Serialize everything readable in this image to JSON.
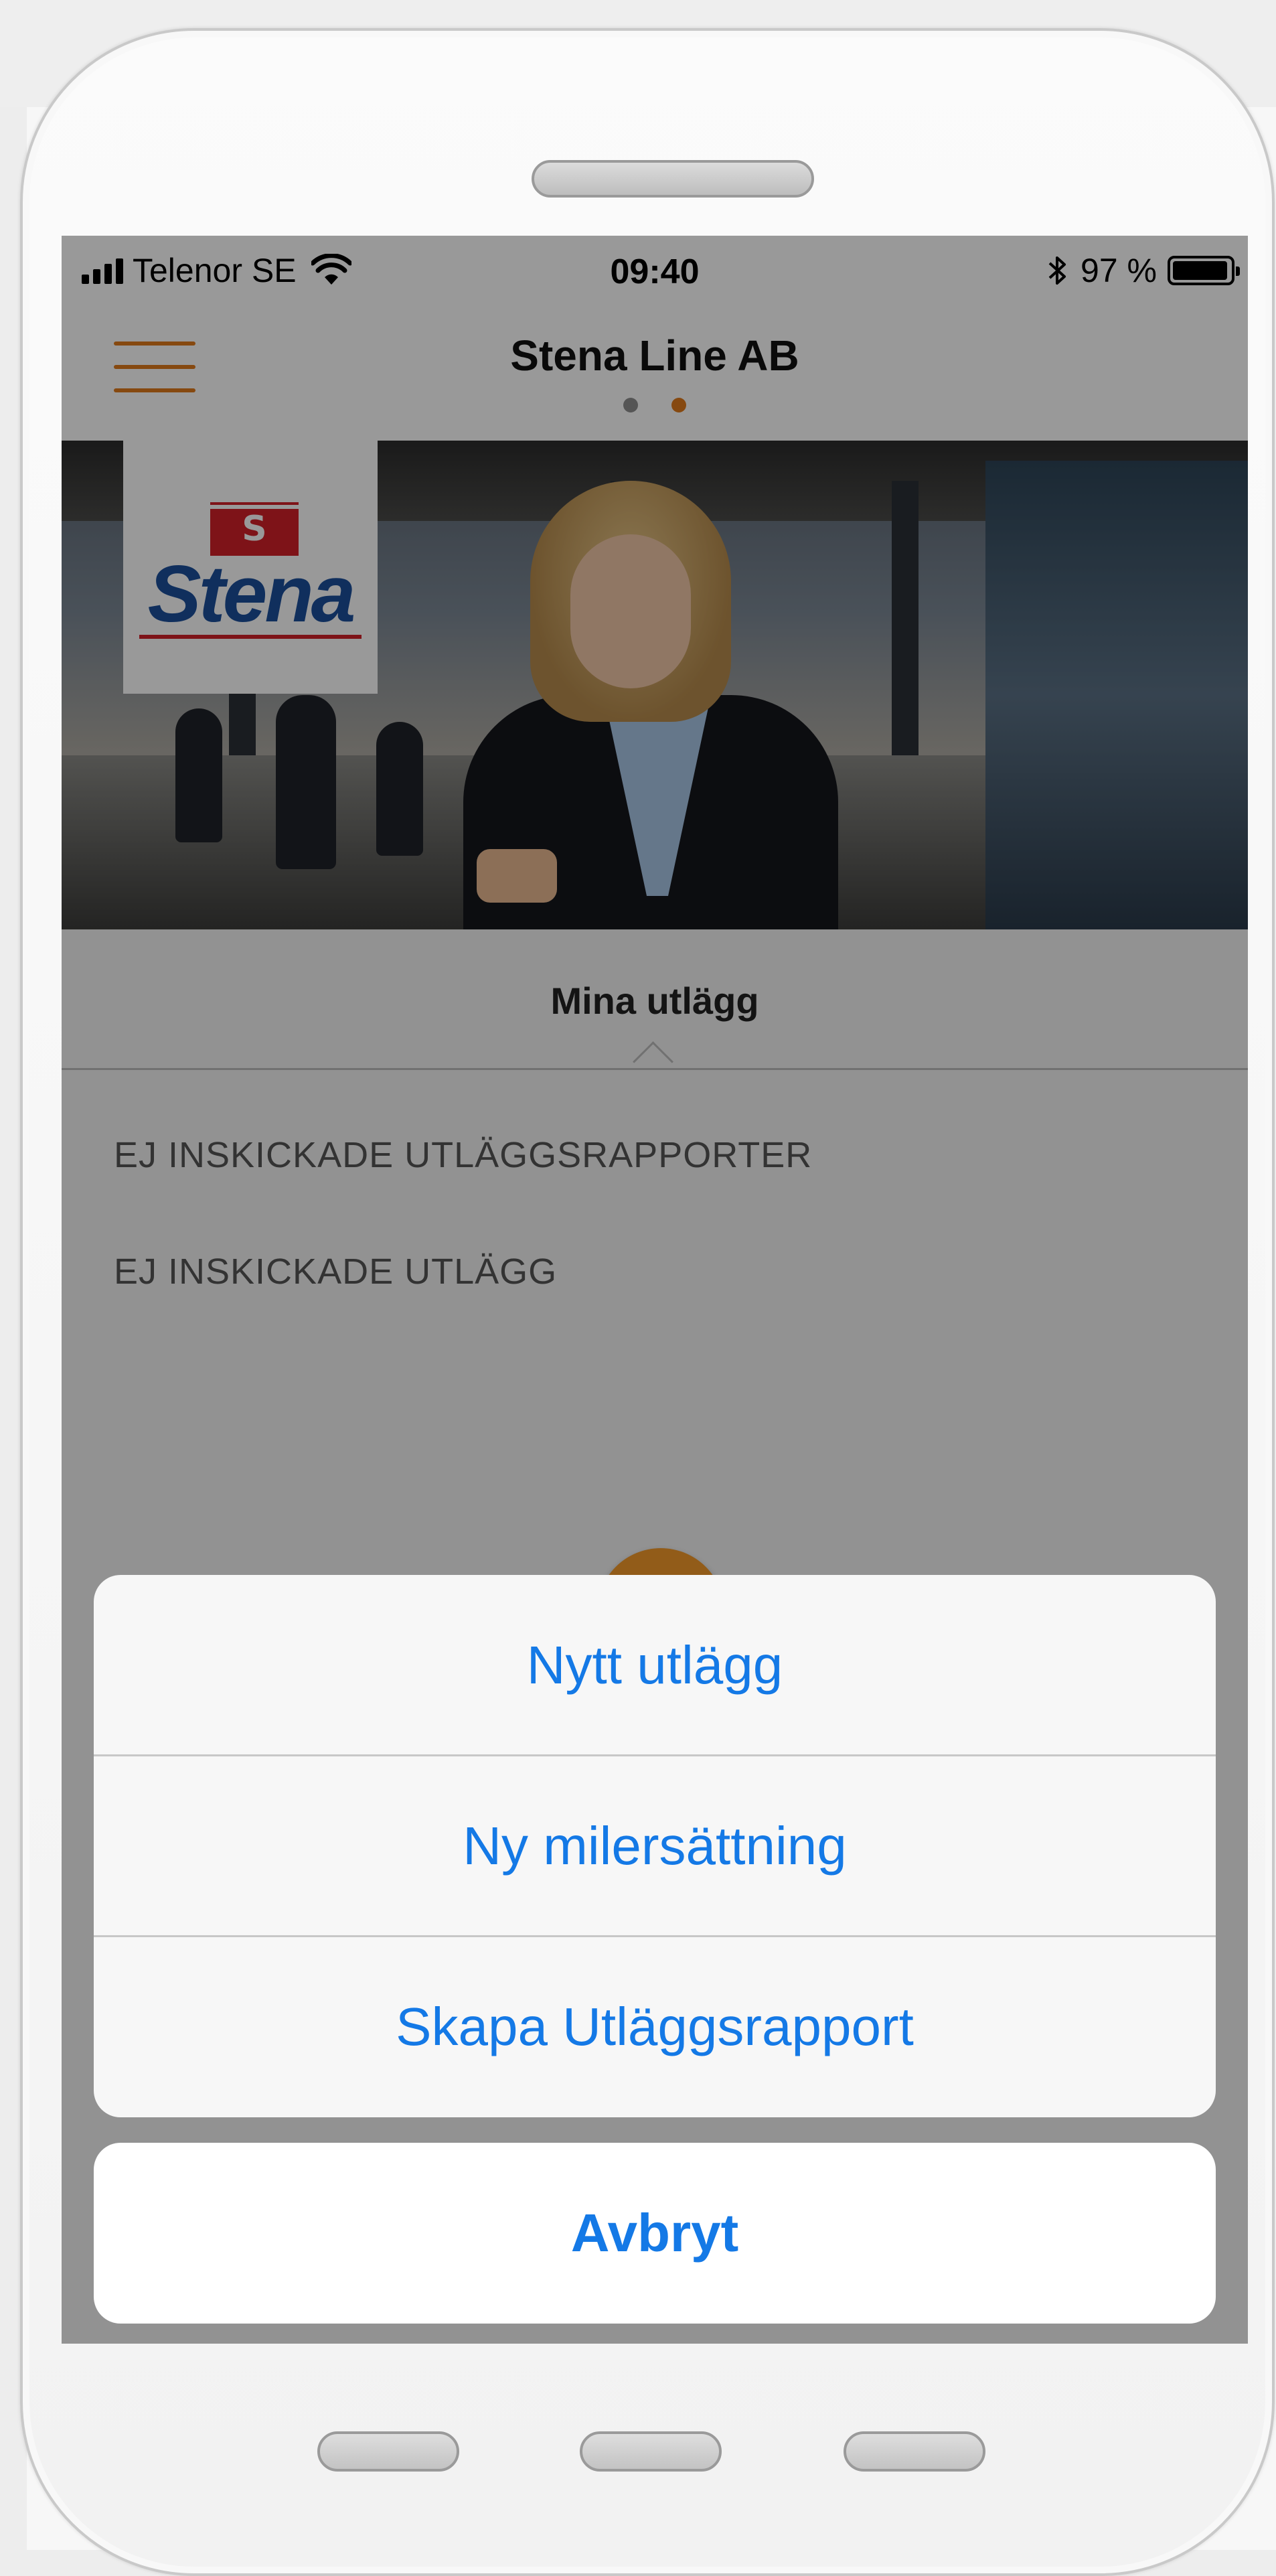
{
  "status_bar": {
    "carrier": "Telenor SE",
    "time": "09:40",
    "battery": "97 %",
    "battery_level": 0.97
  },
  "nav": {
    "title": "Stena Line AB",
    "page_dots": {
      "count": 2,
      "active": 1
    }
  },
  "logo": {
    "flag_letter": "S",
    "text": "Stena"
  },
  "tab": {
    "label": "Mina utlägg"
  },
  "sections": [
    "EJ INSKICKADE UTLÄGGSRAPPORTER",
    "EJ INSKICKADE UTLÄGG"
  ],
  "action_sheet": {
    "options": [
      "Nytt utlägg",
      "Ny milersättning",
      "Skapa Utläggsrapport"
    ],
    "cancel": "Avbryt"
  },
  "colors": {
    "accent": "#e07a1b",
    "action_blue": "#1479e6",
    "dot_inactive": "#8e8e8e",
    "brand_blue": "#1b4f9c",
    "brand_red": "#d32128"
  }
}
